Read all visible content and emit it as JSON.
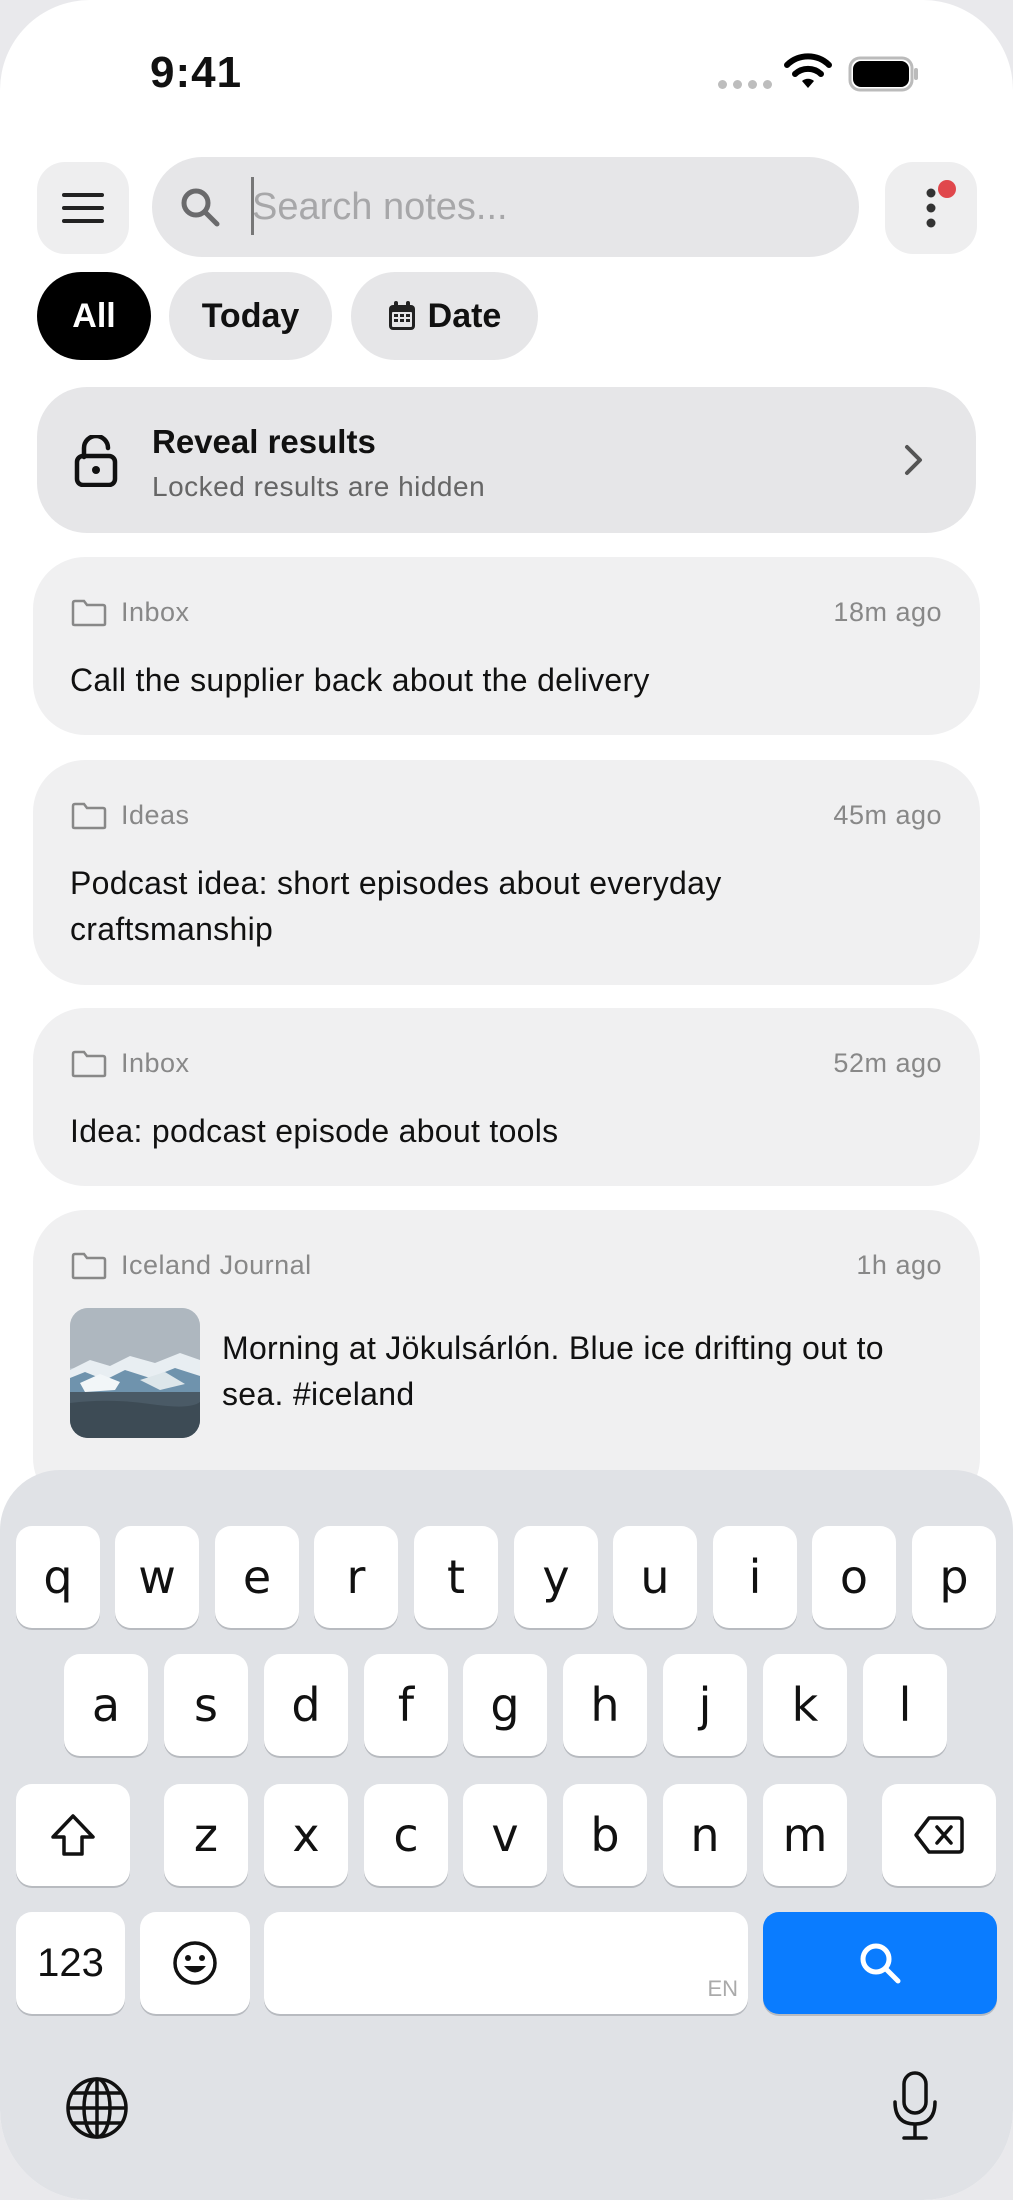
{
  "status_bar": {
    "time": "9:41"
  },
  "header": {
    "search_placeholder": "Search notes...",
    "search_value": ""
  },
  "filters": [
    {
      "label": "All",
      "active": true
    },
    {
      "label": "Today",
      "active": false
    },
    {
      "label": "Date",
      "active": false,
      "icon": "calendar-icon"
    }
  ],
  "reveal": {
    "title": "Reveal results",
    "subtitle": "Locked results are hidden"
  },
  "notes": [
    {
      "folder": "Inbox",
      "time": "18m ago",
      "text": "Call the supplier back about the delivery"
    },
    {
      "folder": "Ideas",
      "time": "45m ago",
      "text": "Podcast idea: short episodes about everyday craftsmanship"
    },
    {
      "folder": "Inbox",
      "time": "52m ago",
      "text": "Idea: podcast episode about tools"
    },
    {
      "folder": "Iceland Journal",
      "time": "1h ago",
      "text": "Morning at Jökulsárlón. Blue ice drifting out to sea. #iceland",
      "thumbnail": "glacier-lagoon-photo"
    }
  ],
  "keyboard": {
    "row1": [
      "q",
      "w",
      "e",
      "r",
      "t",
      "y",
      "u",
      "i",
      "o",
      "p"
    ],
    "row2": [
      "a",
      "s",
      "d",
      "f",
      "g",
      "h",
      "j",
      "k",
      "l"
    ],
    "row3": [
      "z",
      "x",
      "c",
      "v",
      "b",
      "n",
      "m"
    ],
    "numbers_label": "123",
    "space_lang": "EN",
    "accent_color": "#0a7cff"
  }
}
